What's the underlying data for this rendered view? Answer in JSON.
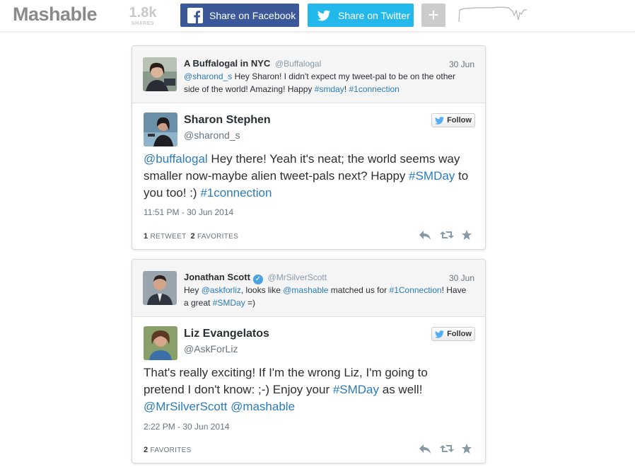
{
  "header": {
    "logo": "Mashable",
    "shares_count": "1.8k",
    "shares_label": "SHARES",
    "facebook_label": "Share on Facebook",
    "twitter_label": "Share on Twitter",
    "more_label": "+"
  },
  "colors": {
    "facebook": "#3b5998",
    "twitter": "#22b8ec",
    "link": "#2b7bb9"
  },
  "tweets": [
    {
      "reply_to": {
        "name": "A Buffalogal in NYC",
        "handle": "@Buffalogal",
        "date": "30 Jun",
        "text_parts": [
          {
            "t": "@sharond_s",
            "link": true
          },
          {
            "t": " Hey Sharon! I didn't expect my tweet-pal to be on the other side of the world! Amazing! Happy ",
            "link": false
          },
          {
            "t": "#smday",
            "link": true
          },
          {
            "t": "! ",
            "link": false
          },
          {
            "t": "#1connection",
            "link": true
          }
        ]
      },
      "author": {
        "name": "Sharon Stephen",
        "handle": "@sharond_s",
        "follow_label": "Follow"
      },
      "text_parts": [
        {
          "t": "@buffalogal",
          "link": true
        },
        {
          "t": " Hey there! Yeah it's neat; the world seems way smaller now-maybe alien tweet-pals next? Happy ",
          "link": false
        },
        {
          "t": "#SMDay",
          "link": true
        },
        {
          "t": " to you too! :) ",
          "link": false
        },
        {
          "t": "#1connection",
          "link": true
        }
      ],
      "timestamp": "11:51 PM - 30 Jun 2014",
      "retweets": "1",
      "retweets_label": "RETWEET",
      "favorites": "2",
      "favorites_label": "FAVORITES"
    },
    {
      "reply_to": {
        "name": "Jonathan Scott",
        "handle": "@MrSilverScott",
        "verified": true,
        "date": "30 Jun",
        "text_parts": [
          {
            "t": "Hey ",
            "link": false
          },
          {
            "t": "@askforliz",
            "link": true
          },
          {
            "t": ", looks like ",
            "link": false
          },
          {
            "t": "@mashable",
            "link": true
          },
          {
            "t": " matched us for ",
            "link": false
          },
          {
            "t": "#1Connection",
            "link": true
          },
          {
            "t": "! Have a great ",
            "link": false
          },
          {
            "t": "#SMDay",
            "link": true
          },
          {
            "t": " =)",
            "link": false
          }
        ]
      },
      "author": {
        "name": "Liz Evangelatos",
        "handle": "@AskForLiz",
        "follow_label": "Follow"
      },
      "text_parts": [
        {
          "t": "That's really exciting! If I'm the wrong Liz, I'm going to pretend I don't know: ;-) Enjoy your ",
          "link": false
        },
        {
          "t": "#SMDay",
          "link": true
        },
        {
          "t": " as well! ",
          "link": false
        },
        {
          "t": "@MrSilverScott",
          "link": true
        },
        {
          "t": " ",
          "link": false
        },
        {
          "t": "@mashable",
          "link": true
        }
      ],
      "timestamp": "2:22 PM - 30 Jun 2014",
      "favorites": "2",
      "favorites_label": "FAVORITES"
    }
  ]
}
